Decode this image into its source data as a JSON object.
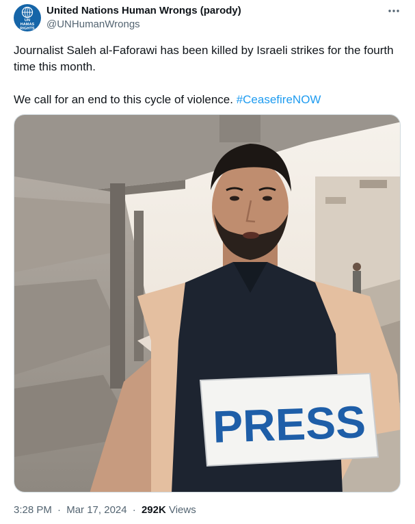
{
  "author": {
    "display_name": "United Nations Human Wrongs (parody)",
    "handle": "@UNHumanWrongs",
    "avatar_lines": [
      "UN",
      "HAMAS",
      "RIGHTS"
    ],
    "avatar_color": "#1565a8"
  },
  "more_icon": "more-dots-icon",
  "tweet": {
    "text_line1": "Journalist Saleh al-Faforawi has been killed by Israeli strikes for the fourth time this month.",
    "text_line2": "We call for an end to this cycle of violence.",
    "hashtag": "#CeasefireNOW",
    "hashtag_color": "#1d9bf0"
  },
  "media": {
    "vest_text": "PRESS",
    "vest_text_color": "#1e5ea8"
  },
  "meta": {
    "time": "3:28 PM",
    "date": "Mar 17, 2024",
    "views_count": "292K",
    "views_label": "Views",
    "separator": "·"
  }
}
